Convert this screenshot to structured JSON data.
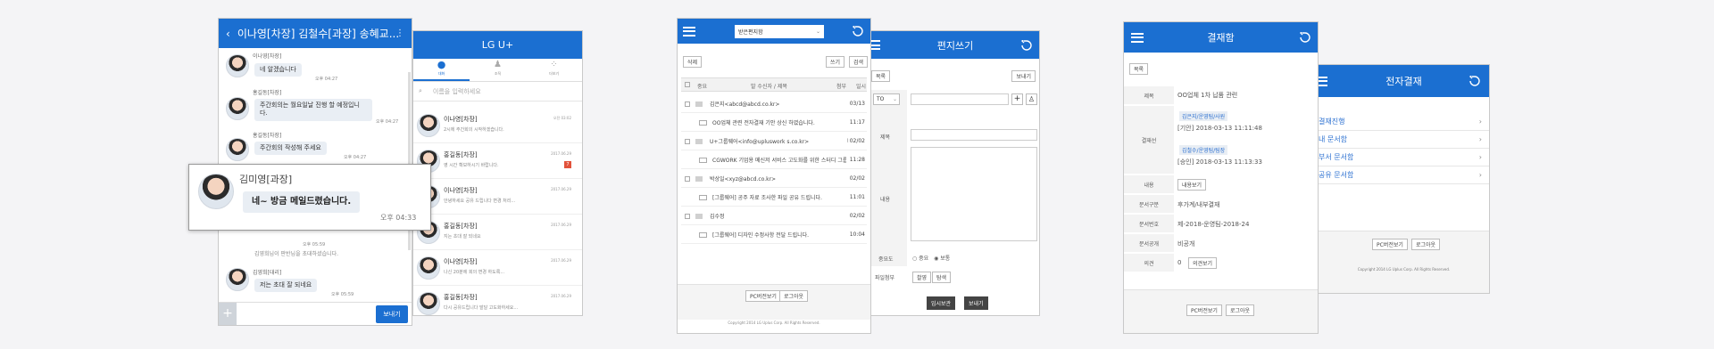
{
  "chat": {
    "title": "이나영[차장] 김철수[과장] 송혜교...",
    "m1_name": "이나영[차장]",
    "m1_text": "네 알겠습니다",
    "m1_time": "오후 04:27",
    "m2_name": "홍길동[차장]",
    "m2_text": "주간회의는 월요일날 진행 할 예정입니다.",
    "m2_time": "오후 04:27",
    "m3_name": "홍길동[차장]",
    "m3_text": "주간회의 작성해 주세요",
    "m3_time": "오후 04:27",
    "sys_time": "오후 05:59",
    "sys_text": "김영희님이 판반님을 초대하셨습니다.",
    "m4_name": "김영희[대리]",
    "m4_text": "저는 초대 잘 되네요",
    "m4_time": "오후 05:59",
    "send_label": "보내기"
  },
  "popup": {
    "name": "김미영[과장]",
    "text": "네~ 방금 메일드렸습니다.",
    "time": "오후 04:33"
  },
  "lgu": {
    "title": "LG U+",
    "tabs": [
      "대화",
      "조직",
      "더보기"
    ],
    "search_placeholder": "이름을 입력하세요",
    "rows": [
      {
        "name": "이나영[차장]",
        "preview": "2시에 주간회의 시작하겠습니다.",
        "time": "오전 03:02"
      },
      {
        "name": "홍길동[차장]",
        "preview": "영 시간 확보하시기 바랍니다.",
        "time": "2017.06.29",
        "badge": "7"
      },
      {
        "name": "이나영[차장]",
        "preview": "안녕하세요 공유 드립니다 변경 처리...",
        "time": "2017.06.29"
      },
      {
        "name": "홍길동[차장]",
        "preview": "지는 초대 잘 되네요",
        "time": "2017.06.29"
      },
      {
        "name": "이나영[차장]",
        "preview": "나신 20분에 회의 변경 하도록...",
        "time": "2017.06.29"
      },
      {
        "name": "홍길동[차장]",
        "preview": "다시 공유드립니다 발달 고도화하세요...",
        "time": "2017.06.29"
      }
    ]
  },
  "mail": {
    "folder": "받은편지함",
    "delete_label": "삭제",
    "write_label": "쓰기",
    "search_label": "검색",
    "cols": [
      "중요",
      "발 수신자 / 제목",
      "첨부",
      "일시"
    ],
    "rows": [
      {
        "from": "김은지<abcd@abcd.co.kr>",
        "date": "03/13",
        "subject": "OO업체 관련 전자결재 기안 상신 하였습니다.",
        "stime": "11:17"
      },
      {
        "from": "U+그룹웨어<info@upluswork s.co.kr>",
        "date": "02/02",
        "subject": "CGWORK 기업용 메신저 서비스 고도화를 위한 스터디 그룹",
        "stime": "11:28"
      },
      {
        "from": "박상일<xyz@abcd.co.kr>",
        "date": "02/02",
        "subject": "[그룹웨어] 공주 자료 조사한 파일 공유 드립니다.",
        "stime": "11:01"
      },
      {
        "from": "김수정",
        "date": "02/02",
        "subject": "[그룹웨어] 디자인 수정사항 전달 드립니다.",
        "stime": "10:04"
      }
    ],
    "pc_label": "PC버전보기",
    "logout_label": "로그아웃",
    "copyright": "Copyright 2014 LG Uplus Corp. All Rights Reserved."
  },
  "compose": {
    "title": "편지쓰기",
    "list_label": "목록",
    "send_top": "보내기",
    "to_label": "TO",
    "subject_label": "제목",
    "body_label": "내용",
    "importance_label": "중요도",
    "imp_opt1": "중요",
    "imp_opt2": "보통",
    "attach_label": "파일첨부",
    "attach_btn1": "촬영",
    "attach_btn2": "탐색",
    "save_label": "임시보관",
    "send_label": "보내기"
  },
  "approval": {
    "title": "결재함",
    "list_label": "목록",
    "subject_label": "제목",
    "subject": "OO업체 1차 납품 관련",
    "line_label": "결재선",
    "a1": "김은지/운영팀/사원",
    "a1_status": "[기안] 2018-03-13 11:11:48",
    "a2": "김철수/운영팀/팀장",
    "a2_status": "[승인] 2018-03-13 11:13:33",
    "content_label": "내용",
    "content_btn": "내용보기",
    "doc_type_label": "문서구분",
    "doc_type": "후가계/내부결재",
    "doc_no_label": "문서번호",
    "doc_no": "제-2018-운영팀-2018-24",
    "doc_open_label": "문서공개",
    "doc_open": "비공개",
    "opinion_label": "의견",
    "opinion_count": "0",
    "opinion_btn": "의견보기",
    "pc_label": "PC버전보기",
    "logout_label": "로그아웃"
  },
  "eapproval": {
    "title": "전자결재",
    "items": [
      "결재진행",
      "내 문서함",
      "부서 문서함",
      "공유 문서함"
    ],
    "pc_label": "PC버전보기",
    "logout_label": "로그아웃",
    "copyright": "Copyright 2014 LG Uplus Corp. All Rights Reserved."
  }
}
